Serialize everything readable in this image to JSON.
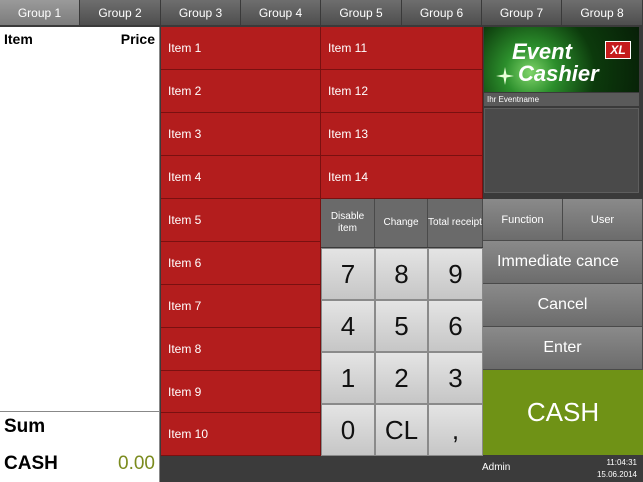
{
  "tabs": [
    "Group 1",
    "Group 2",
    "Group 3",
    "Group 4",
    "Group 5",
    "Group 6",
    "Group 7",
    "Group 8"
  ],
  "active_tab": "Group 1",
  "receipt": {
    "col_item": "Item",
    "col_price": "Price",
    "sum_label": "Sum",
    "cash_label": "CASH",
    "cash_value": "0.00"
  },
  "items_col1": [
    "Item 1",
    "Item 2",
    "Item 3",
    "Item 4",
    "Item 5",
    "Item 6",
    "Item 7",
    "Item 8",
    "Item 9",
    "Item 10"
  ],
  "items_col2": [
    "Item 11",
    "Item 12",
    "Item 13",
    "Item 14"
  ],
  "function_keys": [
    "Disable item",
    "Change",
    "Total receipt"
  ],
  "keypad": [
    "7",
    "8",
    "9",
    "4",
    "5",
    "6",
    "1",
    "2",
    "3",
    "0",
    "CL",
    ","
  ],
  "logo": {
    "line1": "Event",
    "line2": "Cashier",
    "badge": "XL"
  },
  "event_name": "Ihr Eventname",
  "right_buttons": {
    "function": "Function",
    "user": "User",
    "immediate_cancel": "Immediate cance",
    "cancel": "Cancel",
    "enter": "Enter",
    "cash": "CASH"
  },
  "status": {
    "user": "Admin",
    "time": "11:04:31",
    "date": "15.06.2014"
  },
  "colors": {
    "item_red": "#b31d1d",
    "cash_green": "#6f9216",
    "cash_value_green": "#7b8b1e"
  }
}
